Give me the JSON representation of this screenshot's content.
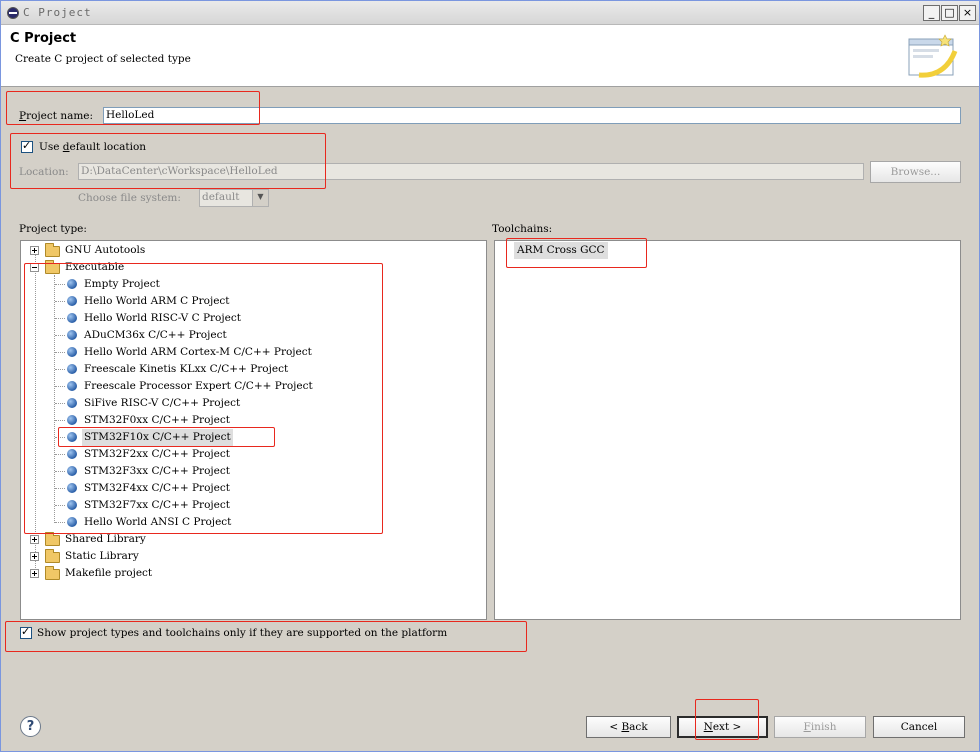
{
  "window": {
    "title": "C Project",
    "minimize": "_",
    "maximize": "□",
    "close": "×"
  },
  "header": {
    "title": "C Project",
    "subtitle": "Create C project of selected type"
  },
  "project_name": {
    "label_accel": "P",
    "label_rest": "roject name:",
    "value": "HelloLed"
  },
  "default_location": {
    "label_pre": "Use ",
    "label_accel": "d",
    "label_rest": "efault location",
    "checked": true
  },
  "location": {
    "label": "Location:",
    "value": "D:\\DataCenter\\cWorkspace\\HelloLed",
    "browse": "Browse..."
  },
  "file_system": {
    "label": "Choose file system:",
    "value": "default"
  },
  "project_type": {
    "heading": "Project type:",
    "groups": [
      {
        "label": "GNU Autotools",
        "expanded": false
      },
      {
        "label": "Executable",
        "expanded": true
      },
      {
        "label": "Shared Library",
        "expanded": false
      },
      {
        "label": "Static Library",
        "expanded": false
      },
      {
        "label": "Makefile project",
        "expanded": false
      }
    ],
    "executable_items": [
      "Empty Project",
      "Hello World ARM C Project",
      "Hello World RISC-V C Project",
      "ADuCM36x C/C++ Project",
      "Hello World ARM Cortex-M C/C++ Project",
      "Freescale Kinetis KLxx C/C++ Project",
      "Freescale Processor Expert C/C++ Project",
      "SiFive RISC-V C/C++ Project",
      "STM32F0xx C/C++ Project",
      "STM32F10x C/C++ Project",
      "STM32F2xx C/C++ Project",
      "STM32F3xx C/C++ Project",
      "STM32F4xx C/C++ Project",
      "STM32F7xx C/C++ Project",
      "Hello World ANSI C Project"
    ],
    "selected": "STM32F10x C/C++ Project"
  },
  "toolchains": {
    "heading": "Toolchains:",
    "items": [
      "ARM Cross GCC"
    ]
  },
  "platform_filter": {
    "label": "Show project types and toolchains only if they are supported on the platform",
    "checked": true
  },
  "buttons": {
    "back_prefix": "< ",
    "back_accel": "B",
    "back_rest": "ack",
    "next_accel": "N",
    "next_rest": "ext >",
    "finish_accel": "F",
    "finish_rest": "inish",
    "cancel": "Cancel"
  },
  "icons": {
    "help": "help-icon",
    "app": "eclipse-icon",
    "banner": "new-project-wizard-banner"
  }
}
